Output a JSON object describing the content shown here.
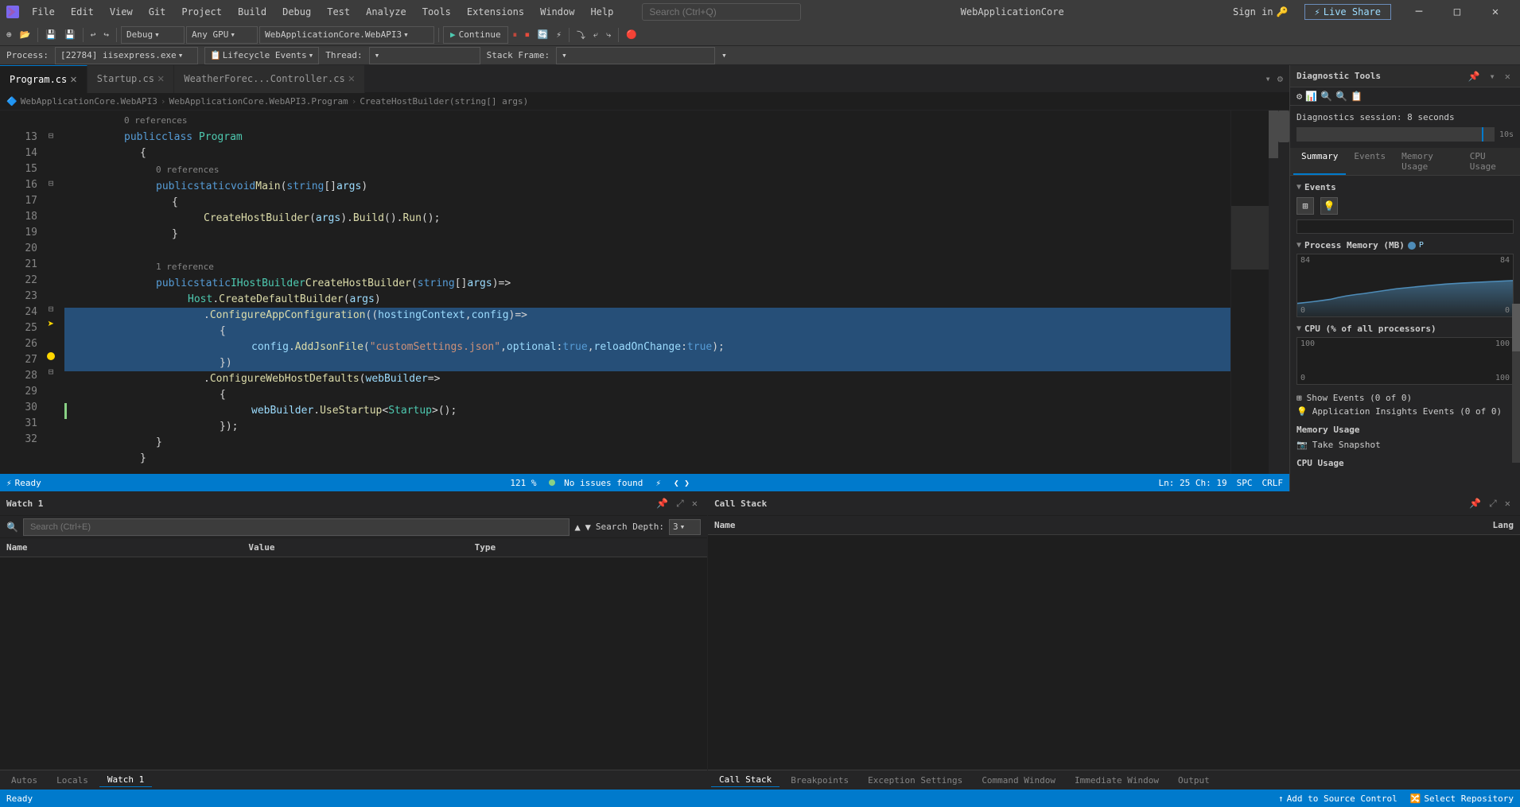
{
  "titlebar": {
    "app_icon": "VS",
    "menu_items": [
      "File",
      "Edit",
      "View",
      "Git",
      "Project",
      "Build",
      "Debug",
      "Test",
      "Analyze",
      "Tools",
      "Extensions",
      "Window",
      "Help"
    ],
    "search_placeholder": "Search (Ctrl+Q)",
    "window_title": "WebApplicationCore",
    "signin_label": "Sign in",
    "liveshare_label": "Live Share"
  },
  "toolbar": {
    "debug_mode": "Debug",
    "platform": "Any GPU",
    "project": "WebApplicationCore.WebAPI3",
    "continue_label": "Continue",
    "process_label": "[22784] iisexpress.exe",
    "lifecycle_label": "Lifecycle Events",
    "thread_label": "Thread:",
    "stack_frame_label": "Stack Frame:"
  },
  "tabs": [
    {
      "name": "Program.cs",
      "active": true
    },
    {
      "name": "Startup.cs",
      "active": false
    },
    {
      "name": "WeatherForec...Controller.cs",
      "active": false
    }
  ],
  "breadcrumb": [
    "WebApplicationCore.WebAPI3",
    "WebApplicationCore.WebAPI3.Program",
    "CreateHostBuilder(string[] args)"
  ],
  "code": {
    "lines": [
      {
        "num": 13,
        "indent": 2,
        "text": "public class Program",
        "type": "class_decl",
        "fold": true,
        "gutter": ""
      },
      {
        "num": 14,
        "indent": 3,
        "text": "{",
        "type": "brace",
        "gutter": ""
      },
      {
        "num": 15,
        "indent": 3,
        "text": "public static void Main(string[] args)",
        "type": "method_decl",
        "fold": true,
        "ref": "0 references",
        "gutter": ""
      },
      {
        "num": 16,
        "indent": 4,
        "text": "{",
        "type": "brace",
        "gutter": ""
      },
      {
        "num": 17,
        "indent": 5,
        "text": "CreateHostBuilder(args).Build().Run();",
        "type": "stmt",
        "gutter": ""
      },
      {
        "num": 18,
        "indent": 4,
        "text": "}",
        "type": "brace",
        "gutter": ""
      },
      {
        "num": 19,
        "indent": 0,
        "text": "",
        "type": "empty",
        "gutter": ""
      },
      {
        "num": 20,
        "indent": 3,
        "text": "public static IHostBuilder CreateHostBuilder(string[] args) =>",
        "type": "method_decl",
        "fold": false,
        "ref": "1 reference",
        "gutter": ""
      },
      {
        "num": 21,
        "indent": 4,
        "text": "Host.CreateDefaultBuilder(args)",
        "type": "stmt",
        "gutter": ""
      },
      {
        "num": 22,
        "indent": 5,
        "text": ".ConfigureAppConfiguration((hostingContext, config) =>",
        "type": "stmt_hl",
        "fold": true,
        "gutter": "",
        "highlighted": true
      },
      {
        "num": 23,
        "indent": 6,
        "text": "{",
        "type": "brace_hl",
        "gutter": "arrow",
        "highlighted": true
      },
      {
        "num": 24,
        "indent": 7,
        "text": "config.AddJsonFile(\"customSettings.json\", optional: true, reloadOnChange: true);",
        "type": "stmt_hl",
        "gutter": "",
        "highlighted": true
      },
      {
        "num": 25,
        "indent": 6,
        "text": "})",
        "type": "brace_hl",
        "gutter": "bp",
        "highlighted": true
      },
      {
        "num": 26,
        "indent": 5,
        "text": ".ConfigureWebHostDefaults(webBuilder =>",
        "type": "stmt",
        "fold": true,
        "gutter": ""
      },
      {
        "num": 27,
        "indent": 6,
        "text": "{",
        "type": "brace",
        "gutter": ""
      },
      {
        "num": 28,
        "indent": 7,
        "text": "webBuilder.UseStartup<Startup>();",
        "type": "stmt",
        "gutter": "green"
      },
      {
        "num": 29,
        "indent": 6,
        "text": "});",
        "type": "brace",
        "gutter": ""
      },
      {
        "num": 30,
        "indent": 3,
        "text": "}",
        "type": "brace",
        "gutter": ""
      },
      {
        "num": 31,
        "indent": 2,
        "text": "}",
        "type": "brace",
        "gutter": ""
      },
      {
        "num": 32,
        "indent": 0,
        "text": "",
        "type": "empty",
        "gutter": ""
      }
    ],
    "ref_13": "0 references",
    "ref_15": "0 references",
    "ref_20": "1 reference"
  },
  "statusbar": {
    "ready": "Ready",
    "no_issues": "No issues found",
    "zoom": "121 %",
    "ln": "Ln: 25",
    "ch": "Ch: 19",
    "encoding": "SPC",
    "line_ending": "CRLF",
    "add_source_control": "Add to Source Control",
    "select_repository": "Select Repository"
  },
  "bottom_tabs": {
    "watch": {
      "title": "Watch 1",
      "search_placeholder": "Search (Ctrl+E)",
      "search_depth_label": "Search Depth:",
      "depth_value": "3",
      "col_name": "Name",
      "col_value": "Value",
      "col_type": "Type"
    },
    "panel_tabs": [
      "Autos",
      "Locals",
      "Watch 1"
    ]
  },
  "callstack": {
    "title": "Call Stack",
    "col_name": "Name",
    "col_lang": "Lang",
    "tabs": [
      "Call Stack",
      "Breakpoints",
      "Exception Settings",
      "Command Window",
      "Immediate Window",
      "Output"
    ]
  },
  "diagnostic": {
    "title": "Diagnostic Tools",
    "session_label": "Diagnostics session: 8 seconds",
    "time_label": "10s",
    "sections": {
      "events": "Events",
      "process_memory": "Process Memory (MB)",
      "cpu": "CPU (% of all processors)"
    },
    "memory_values": {
      "min": "0",
      "max": "84",
      "left": "0",
      "right": "84"
    },
    "cpu_values": {
      "min": "0",
      "max": "100",
      "left": "100",
      "right": "100"
    },
    "tabs": [
      "Summary",
      "Events",
      "Memory Usage",
      "CPU Usage"
    ],
    "events_section": {
      "title": "Events",
      "show_events": "Show Events (0 of 0)",
      "app_insights": "Application Insights Events (0 of 0)"
    },
    "memory_section": {
      "title": "Memory Usage",
      "take_snapshot": "Take Snapshot"
    },
    "cpu_section": {
      "title": "CPU Usage"
    }
  }
}
